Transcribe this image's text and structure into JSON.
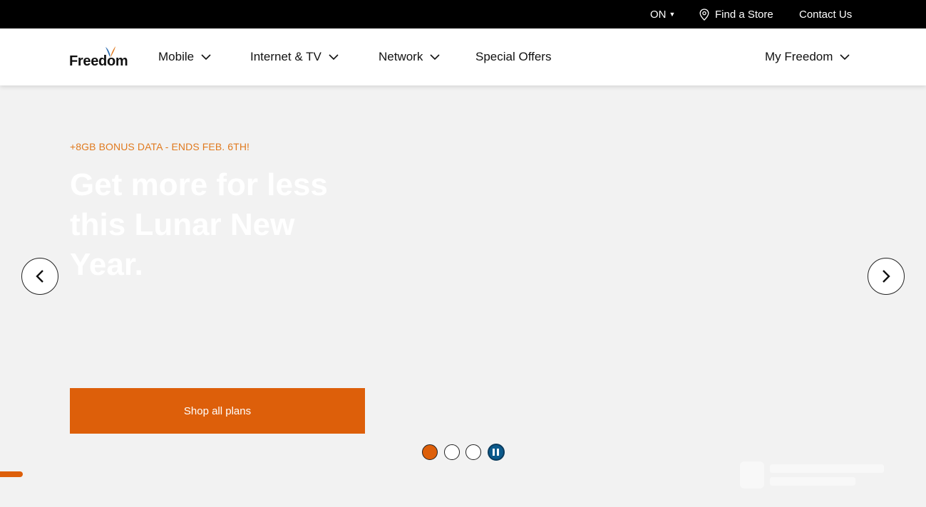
{
  "utility": {
    "province": "ON",
    "find_store": "Find a Store",
    "contact_us": "Contact Us"
  },
  "nav": {
    "logo_text": "Freedom",
    "items": [
      {
        "label": "Mobile"
      },
      {
        "label": "Internet & TV"
      },
      {
        "label": "Network"
      },
      {
        "label": "Special Offers"
      }
    ],
    "account": "My Freedom"
  },
  "hero": {
    "eyebrow": "+8GB BONUS DATA - ENDS FEB. 6TH!",
    "headline": "Get more for less this Lunar New Year.",
    "cta": "Shop all plans"
  },
  "carousel": {
    "slide_count": 3,
    "active_index": 0
  },
  "colors": {
    "brand_orange": "#dd5f0a",
    "eyebrow_orange": "#e07a1f",
    "pause_blue": "#0b5a8c",
    "top_bar": "#000000"
  },
  "icons": [
    "location-pin-icon",
    "chevron-down-icon",
    "chevron-left-icon",
    "chevron-right-icon",
    "pause-icon"
  ]
}
